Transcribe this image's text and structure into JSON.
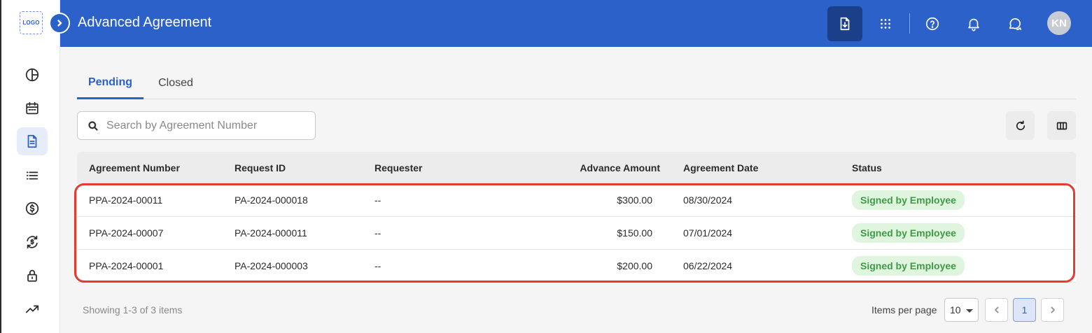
{
  "app": {
    "logo_text": "LOGO",
    "title": "Advanced Agreement",
    "avatar_initials": "KN"
  },
  "header_icons": [
    "download-document-icon",
    "apps-grid-icon",
    "help-icon",
    "bell-icon",
    "chat-icon"
  ],
  "sidebar": {
    "items": [
      {
        "icon": "pie-chart-icon",
        "active": false
      },
      {
        "icon": "calendar-icon",
        "active": false
      },
      {
        "icon": "document-icon",
        "active": true
      },
      {
        "icon": "list-icon",
        "active": false
      },
      {
        "icon": "dollar-icon",
        "active": false
      },
      {
        "icon": "sync-dollar-icon",
        "active": false
      },
      {
        "icon": "lock-icon",
        "active": false
      },
      {
        "icon": "trending-up-icon",
        "active": false
      }
    ]
  },
  "tabs": [
    {
      "label": "Pending",
      "active": true
    },
    {
      "label": "Closed",
      "active": false
    }
  ],
  "search": {
    "placeholder": "Search by Agreement Number",
    "value": ""
  },
  "table": {
    "columns": [
      "Agreement Number",
      "Request ID",
      "Requester",
      "Advance Amount",
      "Agreement Date",
      "Status"
    ],
    "rows": [
      {
        "agreement_number": "PPA-2024-00011",
        "request_id": "PA-2024-000018",
        "requester": "--",
        "amount": "$300.00",
        "date": "08/30/2024",
        "status": "Signed by Employee"
      },
      {
        "agreement_number": "PPA-2024-00007",
        "request_id": "PA-2024-000011",
        "requester": "--",
        "amount": "$150.00",
        "date": "07/01/2024",
        "status": "Signed by Employee"
      },
      {
        "agreement_number": "PPA-2024-00001",
        "request_id": "PA-2024-000003",
        "requester": "--",
        "amount": "$200.00",
        "date": "06/22/2024",
        "status": "Signed by Employee"
      }
    ]
  },
  "footer": {
    "showing": "Showing 1-3 of 3 items",
    "items_per_page_label": "Items per page",
    "items_per_page": "10",
    "current_page": "1"
  },
  "colors": {
    "brand": "#2b61c9",
    "status_bg": "#dff5de",
    "status_text": "#3f9a47",
    "highlight": "#e43b2f"
  }
}
